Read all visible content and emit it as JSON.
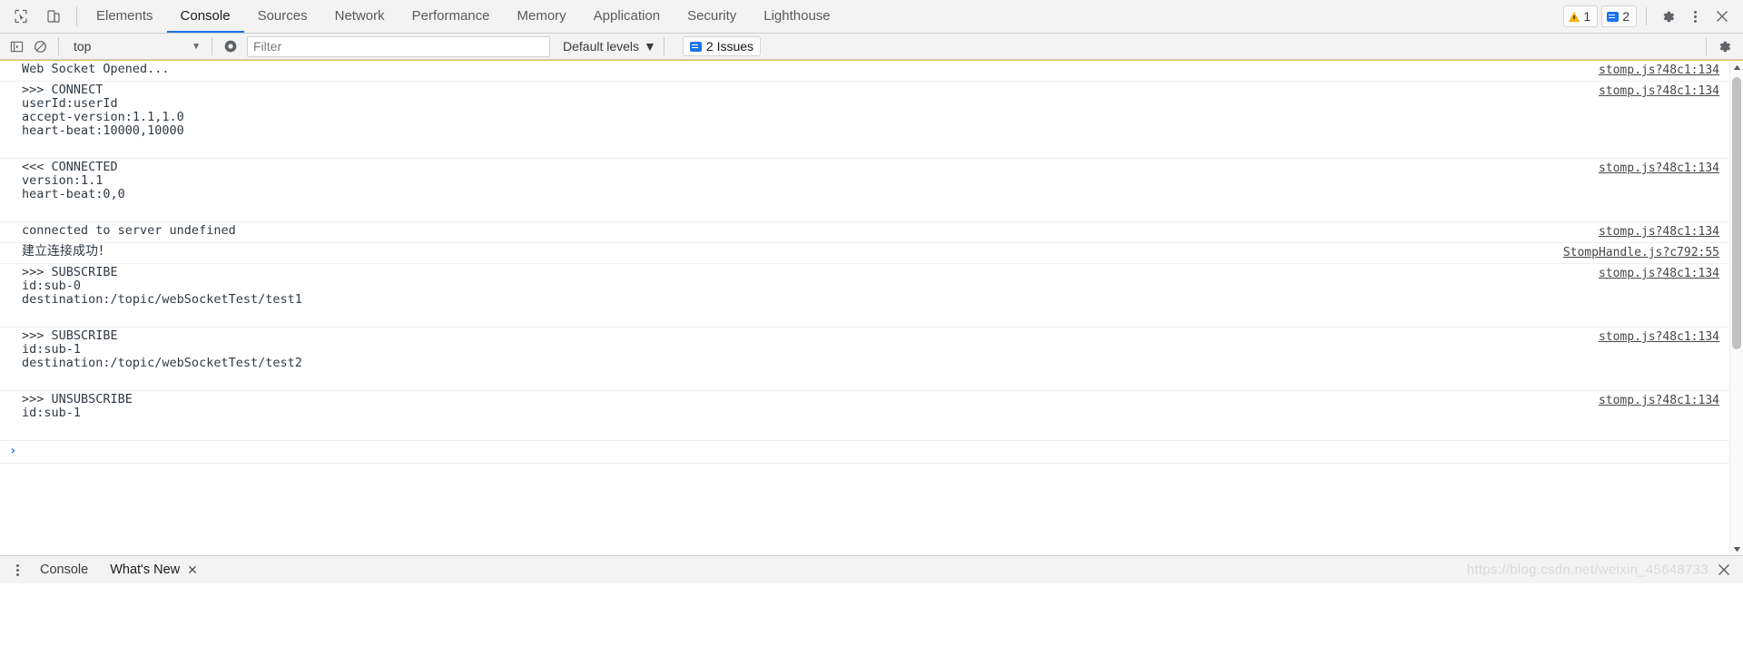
{
  "tabbar": {
    "icons": [
      {
        "name": "inspect-element-icon",
        "title": "Inspect element"
      },
      {
        "name": "device-toolbar-icon",
        "title": "Toggle device toolbar"
      }
    ],
    "tabs": [
      {
        "label": "Elements",
        "active": false
      },
      {
        "label": "Console",
        "active": true
      },
      {
        "label": "Sources",
        "active": false
      },
      {
        "label": "Network",
        "active": false
      },
      {
        "label": "Performance",
        "active": false
      },
      {
        "label": "Memory",
        "active": false
      },
      {
        "label": "Application",
        "active": false
      },
      {
        "label": "Security",
        "active": false
      },
      {
        "label": "Lighthouse",
        "active": false
      }
    ],
    "warning_count": "1",
    "message_count": "2",
    "settings_label": "Settings",
    "more_label": "Customize and control DevTools",
    "close_label": "Close DevTools"
  },
  "filterbar": {
    "sidebar_toggle": "Show console sidebar",
    "clear_console": "Clear console",
    "context": "top",
    "caret": "▼",
    "eye_label": "Create live expression",
    "filter_placeholder": "Filter",
    "filter_value": "",
    "levels_label": "Default levels",
    "levels_caret": "▼",
    "issues_label": "2 Issues",
    "settings_label": "Console settings"
  },
  "console": {
    "messages": [
      {
        "text": "Web Socket Opened...",
        "source": "stomp.js?48c1:134",
        "cjk": false,
        "extra_space": false
      },
      {
        "text": ">>> CONNECT\nuserId:userId\naccept-version:1.1,1.0\nheart-beat:10000,10000",
        "source": "stomp.js?48c1:134",
        "cjk": false,
        "extra_space": true
      },
      {
        "text": "<<< CONNECTED\nversion:1.1\nheart-beat:0,0",
        "source": "stomp.js?48c1:134",
        "cjk": false,
        "extra_space": true
      },
      {
        "text": "connected to server undefined",
        "source": "stomp.js?48c1:134",
        "cjk": false,
        "extra_space": false
      },
      {
        "text": "建立连接成功！",
        "source": "StompHandle.js?c792:55",
        "cjk": true,
        "extra_space": false
      },
      {
        "text": ">>> SUBSCRIBE\nid:sub-0\ndestination:/topic/webSocketTest/test1",
        "source": "stomp.js?48c1:134",
        "cjk": false,
        "extra_space": true
      },
      {
        "text": ">>> SUBSCRIBE\nid:sub-1\ndestination:/topic/webSocketTest/test2",
        "source": "stomp.js?48c1:134",
        "cjk": false,
        "extra_space": true
      },
      {
        "text": ">>> UNSUBSCRIBE\nid:sub-1",
        "source": "stomp.js?48c1:134",
        "cjk": false,
        "extra_space": true
      }
    ],
    "prompt_symbol": "›",
    "prompt_value": ""
  },
  "drawer": {
    "more_label": "More tools",
    "tabs": [
      {
        "label": "Console",
        "closable": false,
        "active": false
      },
      {
        "label": "What's New",
        "closable": true,
        "active": true
      }
    ],
    "close_symbol": "✕",
    "drawer_close_label": "Close drawer"
  },
  "watermark": "https://blog.csdn.net/weixin_45648733"
}
